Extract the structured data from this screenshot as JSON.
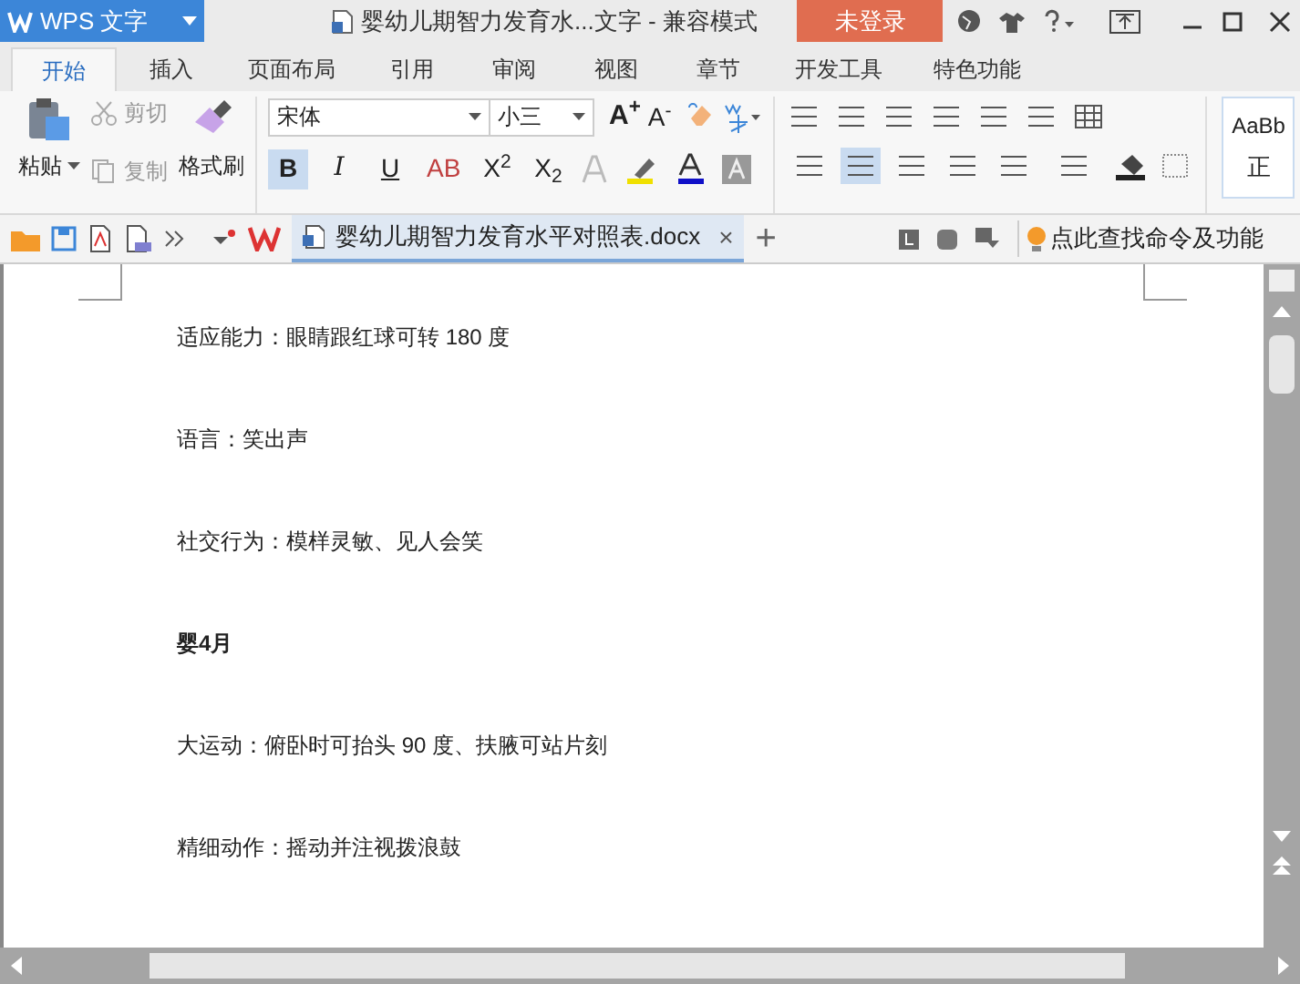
{
  "app_button": {
    "label": "WPS 文字"
  },
  "window": {
    "title": "婴幼儿期智力发育水...文字 - 兼容模式",
    "login": "未登录"
  },
  "tabs": [
    {
      "label": "开始",
      "selected": true
    },
    {
      "label": "插入",
      "selected": false
    },
    {
      "label": "页面布局",
      "selected": false
    },
    {
      "label": "引用",
      "selected": false
    },
    {
      "label": "审阅",
      "selected": false
    },
    {
      "label": "视图",
      "selected": false
    },
    {
      "label": "章节",
      "selected": false
    },
    {
      "label": "开发工具",
      "selected": false
    },
    {
      "label": "特色功能",
      "selected": false
    }
  ],
  "clipboard": {
    "paste": "粘贴",
    "cut": "剪切",
    "copy": "复制",
    "format_painter": "格式刷"
  },
  "font": {
    "name": "宋体",
    "size": "小三",
    "grow": "A$^{+}$",
    "shrink": "A$^{-}$"
  },
  "format_buttons": [
    {
      "label": "B",
      "selected": true
    },
    {
      "label": "I",
      "selected": false
    },
    {
      "label": "U",
      "selected": false
    },
    {
      "label": "AB",
      "selected": false
    },
    {
      "label": "X$^{2}$",
      "selected": false
    },
    {
      "label": "X$_{2}$",
      "selected": false
    }
  ],
  "align_buttons": [
    {
      "selected": false
    },
    {
      "selected": true
    },
    {
      "selected": false
    },
    {
      "selected": false
    },
    {
      "selected": false
    }
  ],
  "styles": {
    "sample": "AaBb",
    "name": "正"
  },
  "doc_tab": {
    "title": "婴幼儿期智力发育水平对照表.docx",
    "close": "×",
    "add": "+"
  },
  "search_hint": "点此查找命令及功能",
  "document": {
    "paragraphs": [
      {
        "text": "适应能力：眼睛跟红球可转 180 度",
        "bold": false
      },
      {
        "text": "语言：笑出声",
        "bold": false
      },
      {
        "text": "社交行为：模样灵敏、见人会笑",
        "bold": false
      },
      {
        "text": "婴4月",
        "bold": true
      },
      {
        "text": "大运动：俯卧时可抬头 90 度、扶腋可站片刻",
        "bold": false
      },
      {
        "text": "精细动作：摇动并注视拨浪鼓",
        "bold": false
      }
    ]
  }
}
